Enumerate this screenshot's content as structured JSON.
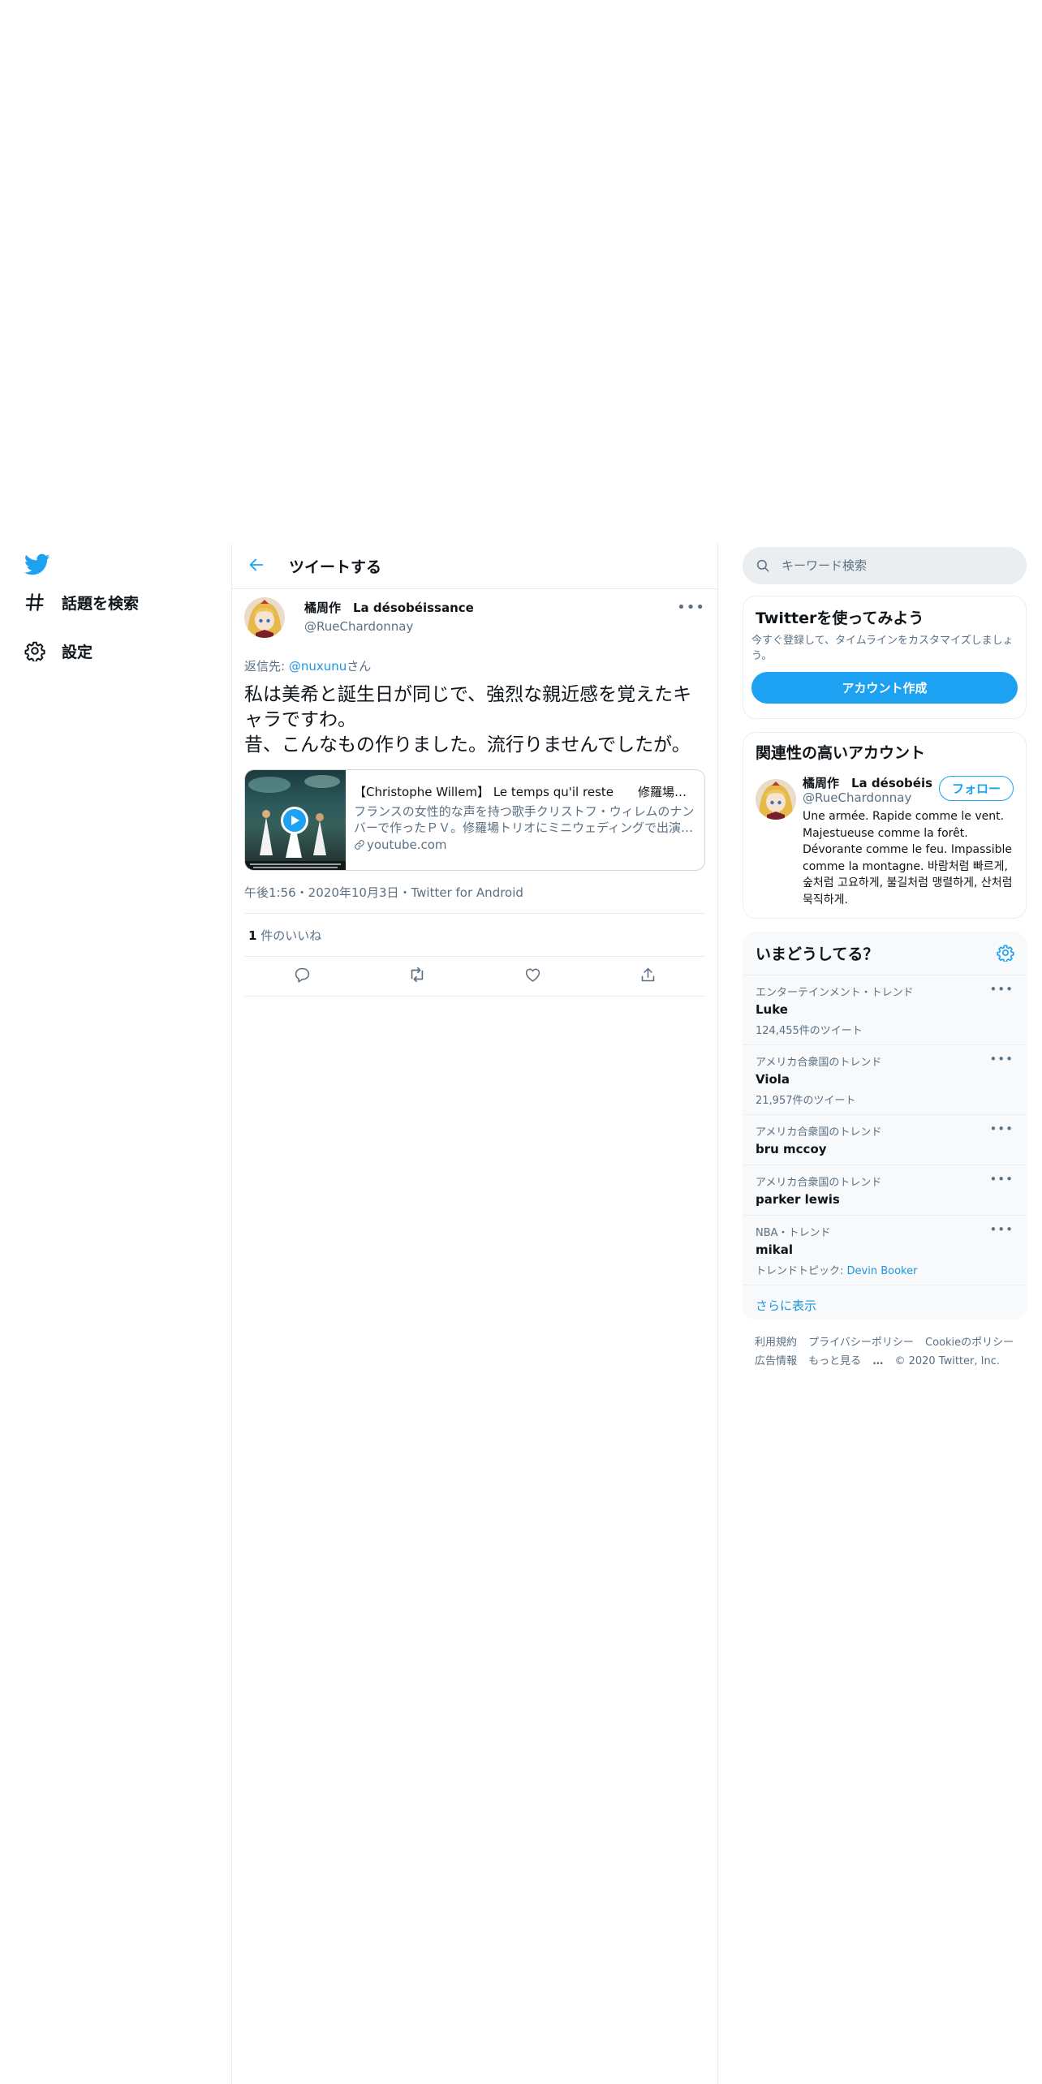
{
  "nav": {
    "items": [
      {
        "label": "話題を検索",
        "icon": "hashtag-icon"
      },
      {
        "label": "設定",
        "icon": "gear-icon"
      }
    ]
  },
  "header": {
    "title": "ツイートする"
  },
  "tweet": {
    "name": "橘周作　La désobéissance",
    "handle": "@RueChardonnay",
    "replying_prefix": "返信先: ",
    "replying_mention": "@nuxunu",
    "replying_suffix": "さん",
    "text_line1": "私は美希と誕生日が同じで、強烈な親近感を覚えたキャラですわ。",
    "text_line2": "昔、こんなもの作りました。流行りませんでしたが。",
    "card": {
      "title": "【Christophe Willem】 Le temps qu'il reste　　修羅場トリオ",
      "description": "フランスの女性的な声を持つ歌手クリストフ・ウィレムのナンバーで作ったＰＶ。修羅場トリオにミニウェディングで出演…",
      "domain": "youtube.com"
    },
    "meta": "午後1:56・2020年10月3日・Twitter for Android",
    "likes_count": "1",
    "likes_label": " 件のいいね"
  },
  "search": {
    "placeholder": "キーワード検索"
  },
  "signup": {
    "title": "Twitterを使ってみよう",
    "subtitle": "今すぐ登録して、タイムラインをカスタマイズしましょう。",
    "button": "アカウント作成"
  },
  "related": {
    "title": "関連性の高いアカウント",
    "name": "橘周作　La désobéis...",
    "handle": "@RueChardonnay",
    "follow": "フォロー",
    "bio": "Une armée. Rapide comme le vent. Majestueuse comme la forêt. Dévorante comme le feu. Impassible comme la montagne. 바람처럼 빠르게, 숲처럼 고요하게, 불길처럼 맹렬하게, 산처럼 묵직하게."
  },
  "trends": {
    "title": "いまどうしてる？",
    "items": [
      {
        "meta": "エンターテインメント・トレンド",
        "name": "Luke",
        "count": "124,455件のツイート"
      },
      {
        "meta": "アメリカ合衆国のトレンド",
        "name": "Viola",
        "count": "21,957件のツイート"
      },
      {
        "meta": "アメリカ合衆国のトレンド",
        "name": "bru mccoy",
        "count": ""
      },
      {
        "meta": "アメリカ合衆国のトレンド",
        "name": "parker lewis",
        "count": ""
      },
      {
        "meta": "NBA・トレンド",
        "name": "mikal",
        "count": ""
      }
    ],
    "topic_label": "トレンドトピック: ",
    "topic_value": "Devin Booker",
    "show_more": "さらに表示"
  },
  "footer": {
    "terms": "利用規約",
    "privacy": "プライバシーポリシー",
    "cookie": "Cookieのポリシー",
    "ads": "広告情報",
    "more": "もっと見る",
    "copyright": "© 2020 Twitter, Inc."
  },
  "colors": {
    "accent": "#1da1f2",
    "link": "#1b95e0",
    "muted": "#5b7083"
  }
}
